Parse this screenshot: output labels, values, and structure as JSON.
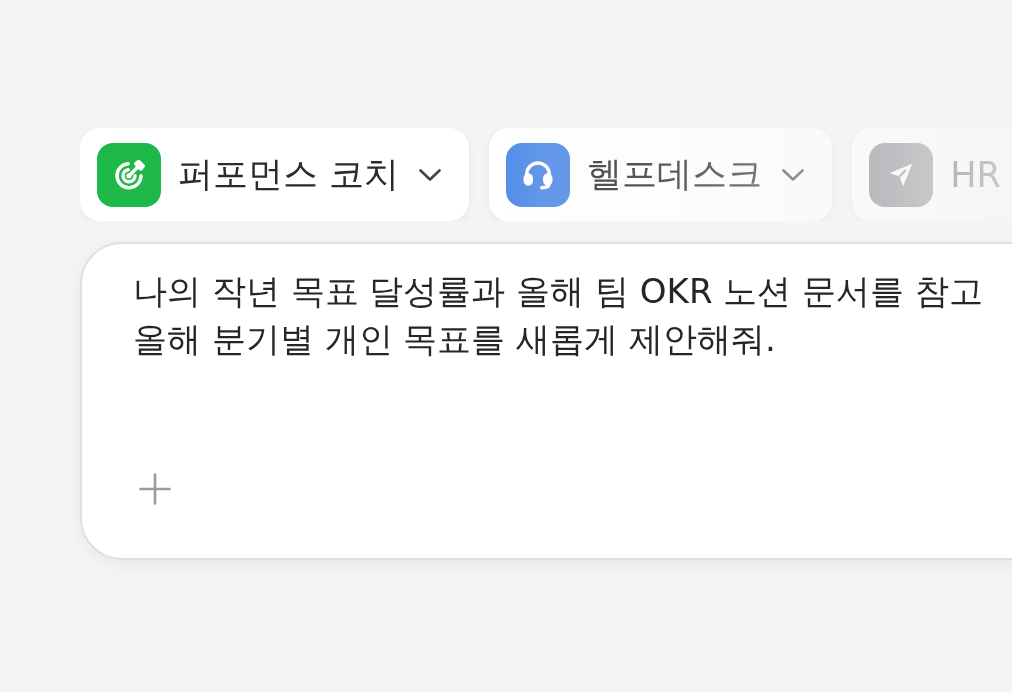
{
  "agents": [
    {
      "kind": "target",
      "label": "퍼포먼스 코치",
      "dropdown": true
    },
    {
      "kind": "headset",
      "label": "헬프데스크",
      "dropdown": true
    },
    {
      "kind": "send",
      "label": "HR",
      "dropdown": false
    }
  ],
  "composer": {
    "value": "나의 작년 목표 달성률과 올해 팀 OKR 노션 문서를 참고\n올해 분기별 개인 목표를 새롭게 제안해줘."
  }
}
